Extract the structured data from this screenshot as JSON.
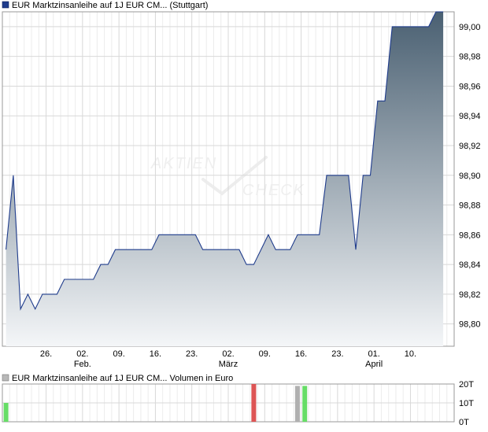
{
  "colors": {
    "price_line": "#1f3c8c",
    "legend_square": "#1f3c8c",
    "area_top": "#4a6072",
    "area_bottom": "#f4f6f8",
    "grid": "#d8d8d8",
    "volume_green": "#66dd66",
    "volume_red": "#dd5555",
    "volume_gray": "#b0b0b0",
    "volume_legend_square": "#b8b8b8"
  },
  "watermark": {
    "line1": "AKTIEN",
    "line2": "CHECK"
  },
  "chart_data": [
    {
      "type": "area",
      "title": "EUR Marktzinsanleihe auf 1J EUR CM... (Stuttgart)",
      "ylim": [
        98.785,
        99.01
      ],
      "y_ticks": [
        "99,00",
        "98,98",
        "98,96",
        "98,94",
        "98,92",
        "98,90",
        "98,88",
        "98,86",
        "98,84",
        "98,82",
        "98,80"
      ],
      "x_ticks": [
        {
          "day": 20.5,
          "label": "26."
        },
        {
          "day": 25.5,
          "label": "02.",
          "sublabel": "Feb."
        },
        {
          "day": 30.5,
          "label": "09."
        },
        {
          "day": 35.5,
          "label": "16."
        },
        {
          "day": 40.5,
          "label": "23."
        },
        {
          "day": 45.5,
          "label": "02.",
          "sublabel": "März"
        },
        {
          "day": 50.5,
          "label": "09."
        },
        {
          "day": 55.5,
          "label": "16."
        },
        {
          "day": 60.5,
          "label": "23."
        },
        {
          "day": 65.5,
          "label": "01.",
          "sublabel": "April"
        },
        {
          "day": 70.5,
          "label": "10."
        }
      ],
      "grid": true,
      "series": [
        {
          "points": [
            [
              15.0,
              98.85
            ],
            [
              16.0,
              98.9
            ],
            [
              17.0,
              98.81
            ],
            [
              18.0,
              98.82
            ],
            [
              19.0,
              98.81
            ],
            [
              20.0,
              98.82
            ],
            [
              22.0,
              98.82
            ],
            [
              23.0,
              98.83
            ],
            [
              24.0,
              98.83
            ],
            [
              27.0,
              98.83
            ],
            [
              28.0,
              98.84
            ],
            [
              29.0,
              98.84
            ],
            [
              30.0,
              98.85
            ],
            [
              35.0,
              98.85
            ],
            [
              36.0,
              98.86
            ],
            [
              41.0,
              98.86
            ],
            [
              42.0,
              98.85
            ],
            [
              47.0,
              98.85
            ],
            [
              48.0,
              98.84
            ],
            [
              49.0,
              98.84
            ],
            [
              51.0,
              98.86
            ],
            [
              52.0,
              98.85
            ],
            [
              54.0,
              98.85
            ],
            [
              55.0,
              98.86
            ],
            [
              58.0,
              98.86
            ],
            [
              59.0,
              98.9
            ],
            [
              62.0,
              98.9
            ],
            [
              63.0,
              98.85
            ],
            [
              64.0,
              98.9
            ],
            [
              65.0,
              98.9
            ],
            [
              66.0,
              98.95
            ],
            [
              67.0,
              98.95
            ],
            [
              68.0,
              99.0
            ],
            [
              73.0,
              99.0
            ],
            [
              74.0,
              99.01
            ],
            [
              75.0,
              99.01
            ]
          ]
        }
      ]
    },
    {
      "type": "bar",
      "title": "EUR Marktzinsanleihe auf 1J EUR CM... Volumen in Euro",
      "ylim": [
        0,
        20
      ],
      "y_ticks": [
        "20T",
        "10T",
        "0T"
      ],
      "bars": [
        {
          "day": 15.0,
          "value": 10,
          "color": "green"
        },
        {
          "day": 49.0,
          "value": 25,
          "color": "red"
        },
        {
          "day": 55.0,
          "value": 19,
          "color": "gray"
        },
        {
          "day": 56.0,
          "value": 19,
          "color": "green"
        }
      ]
    }
  ]
}
